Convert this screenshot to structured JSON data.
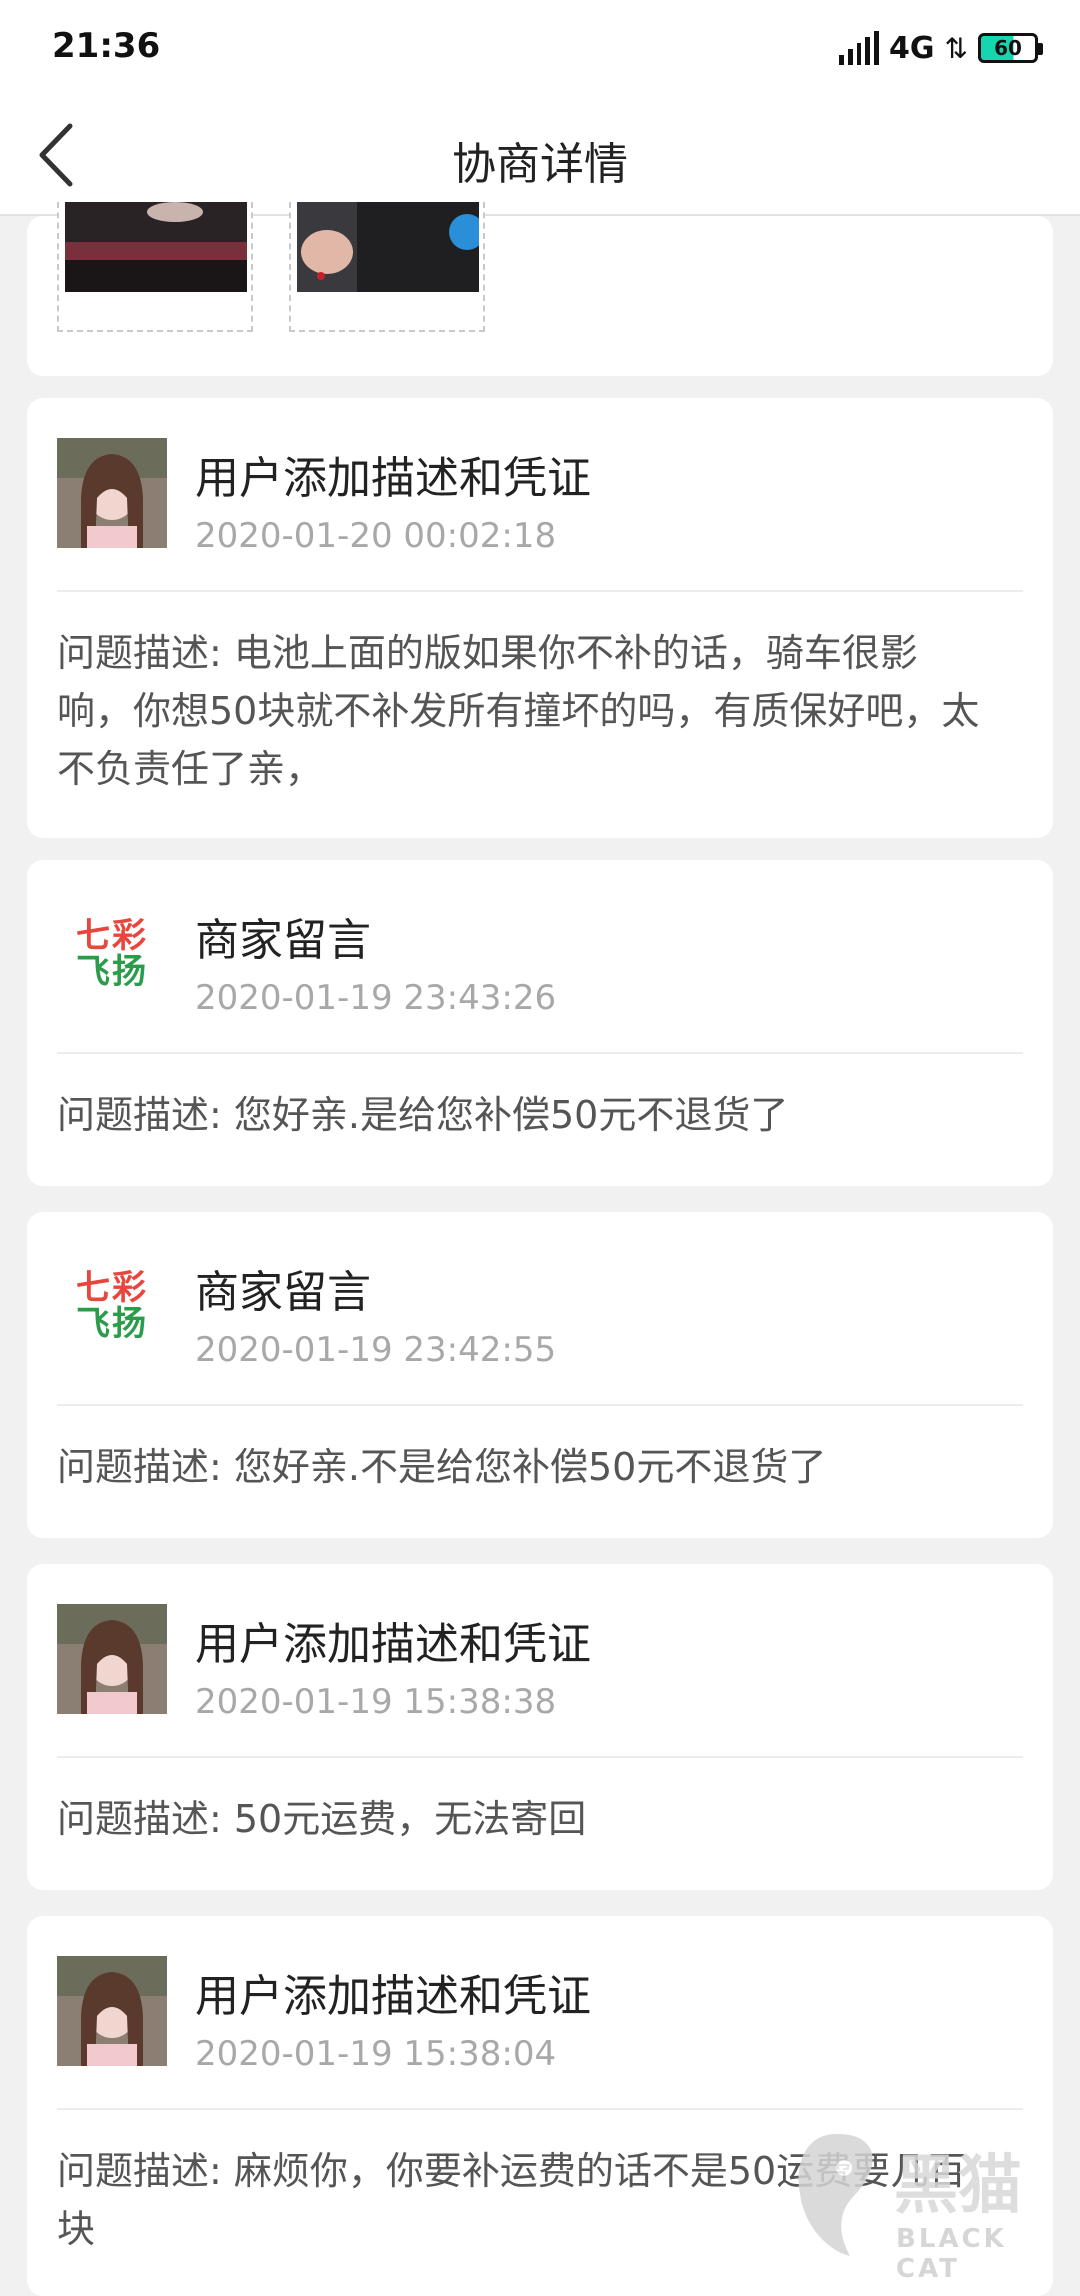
{
  "status_bar": {
    "time": "21:36",
    "network": "4G",
    "battery": "60",
    "battery_level": 0.6
  },
  "header": {
    "title": "协商详情",
    "back_icon": "back-chevron-icon"
  },
  "entries": [
    {
      "type": "user",
      "title": "用户添加描述和凭证",
      "time": "2020-01-20 00:02:18",
      "body": "问题描述: 电池上面的版如果你不补的话，骑车很影响，你想50块就不补发所有撞坏的吗，有质保好吧，太不负责任了亲，"
    },
    {
      "type": "merchant",
      "title": "商家留言",
      "time": "2020-01-19 23:43:26",
      "body": "问题描述: 您好亲.是给您补偿50元不退货了"
    },
    {
      "type": "merchant",
      "title": "商家留言",
      "time": "2020-01-19 23:42:55",
      "body": "问题描述: 您好亲.不是给您补偿50元不退货了"
    },
    {
      "type": "user",
      "title": "用户添加描述和凭证",
      "time": "2020-01-19 15:38:38",
      "body": "问题描述: 50元运费，无法寄回"
    },
    {
      "type": "user",
      "title": "用户添加描述和凭证",
      "time": "2020-01-19 15:38:04",
      "body": "问题描述: 麻烦你，你要补运费的话不是50运费要几百块"
    }
  ],
  "merchant_logo": {
    "line1": "七彩",
    "line2": "飞扬"
  },
  "watermark": {
    "text": "黑猫",
    "sub": "BLACK CAT"
  },
  "colors": {
    "accent_battery": "#16d6b0",
    "time_text": "#a8a8a8",
    "background": "#f1f1f1"
  }
}
